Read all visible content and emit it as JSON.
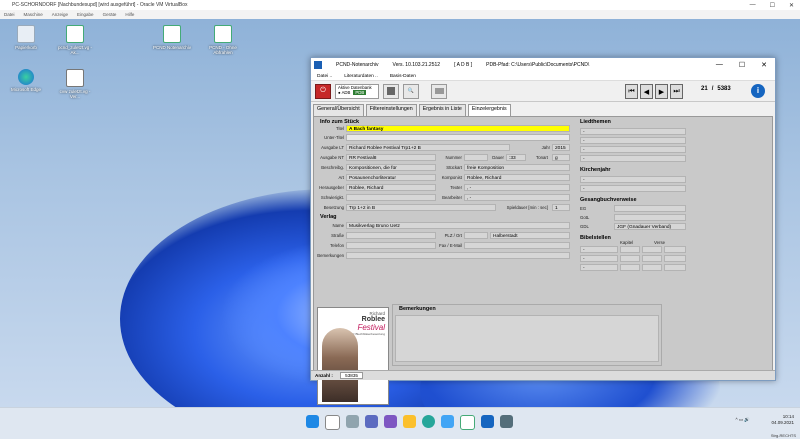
{
  "vbox": {
    "title": "PC-SCHORNDORF [Nachbundesupd] [wird ausgeführt] - Oracle VM VirtualBox",
    "menu": [
      "Datei",
      "Maschine",
      "Anzeige",
      "Eingabe",
      "Geräte",
      "Hilfe"
    ]
  },
  "desktop_icons": [
    {
      "label": "Papierkorb"
    },
    {
      "label": "pcnd_zuletzt.vg - Ak..."
    },
    {
      "label": "PCND Notenarchiv"
    },
    {
      "label": "PCND - Ohne Abfrahlen"
    },
    {
      "label": "Microsoft Edge"
    },
    {
      "label": "cvw zuletzt.vg - Ver..."
    }
  ],
  "app": {
    "title": "PCND-Notenarchiv",
    "version": "Vers. 10.103.21.2512",
    "adb": "[ A D B ]",
    "path": "PDB-Pfad: C:\\Users\\Public\\Documents\\PCND\\",
    "menu": [
      "Datei ..",
      "Literaturdaten ..",
      "Basis-Daten"
    ],
    "aktive_db_label": "Aktive Datenbank",
    "db_options": [
      "ADB",
      "PDB"
    ],
    "record_pos": "21",
    "record_sep": "/",
    "record_total": "5383",
    "tabs": [
      "General/Übersicht",
      "Filtereinstellungen",
      "Ergebnis in Liste",
      "Einzelergebnis"
    ],
    "info_section": "Info zum Stück",
    "fields": {
      "titel_l": "Titel",
      "titel": "A Bach fantasy",
      "untertitel_l": "Unter-Titel",
      "untertitel": "",
      "ausgabe_lt_l": "Ausgabe LT",
      "ausgabe_lt": "Richard Roblee Festival Trp1+2 B",
      "jahr_l": "Jahr",
      "jahr": "2015",
      "ausgabe_nt_l": "Ausgabe NT",
      "ausgabe_nt": "RR Festival8",
      "nummer_l": "Nummer",
      "nummer": "",
      "dauer_l": "Dauer",
      "dauer": ":33",
      "tonart_l": "Tonart",
      "tonart": "g",
      "beschreibung_l": "Beschreibg.",
      "beschreibung": "Kompositionen, die für",
      "stueckart_l": "Stückart",
      "stueckart": "freie Komposition",
      "art_l": "Art",
      "art": "Posaunenchorliteratur",
      "komponist_l": "Komponist",
      "komponist": "Roblee, Richard",
      "herausgeber_l": "Herausgeber",
      "herausgeber": "Roblee, Richard",
      "texter_l": "Texter",
      "texter": ", -",
      "schwierig_l": "Schwierigkt.",
      "schwierig": "",
      "bearbeiter_l": "Bearbeiter",
      "bearbeiter": ", -",
      "besetzung_l": "Besetzung",
      "besetzung": "Trp 1+2 in B",
      "spieldauer_l": "Spieldauer [min : sec]",
      "spieldauer": "1"
    },
    "verlag_section": "Verlag",
    "verlag": {
      "name_l": "Name",
      "name": "Musikverlag Bruno Uetz",
      "strasse_l": "Straße",
      "strasse": "",
      "plz_l": "PLZ / Ort",
      "plz": "",
      "ort": "Halberstadt",
      "telefon_l": "Telefon",
      "telefon": "",
      "fax_l": "Fax / E-Mail",
      "fax": "",
      "bemerkungen_l": "Bemerkungen",
      "bemerkungen": ""
    },
    "bemerkungen_section": "Bemerkungen",
    "liedthemen_section": "Liedthemen",
    "liedthemen": [
      "-",
      "-",
      "-",
      "-"
    ],
    "kirchenjahr_section": "Kirchenjahr",
    "kirchenjahr": [
      "-",
      "-"
    ],
    "gesang_section": "Gesangbuchverweise",
    "gesang": [
      {
        "l": "EG",
        "v": ""
      },
      {
        "l": "GotL",
        "v": ""
      },
      {
        "l": "GDL",
        "v": "JGF (Gnadauer Verband)"
      }
    ],
    "bibel_section": "Bibelstellen",
    "bibel_headers": [
      "Kapitel",
      "Verse"
    ],
    "bibel_rows": [
      "-",
      "-",
      "-"
    ],
    "cover": {
      "name": "Richard",
      "surname": "Roblee",
      "title": "Festival",
      "sub": "für Blechbläserbesetzung"
    },
    "status_label": "Anzahl :",
    "status_value": "53835"
  },
  "taskbar": {
    "time": "10:14",
    "date": "04.09.2021",
    "lang": "Strg-RECHTS"
  }
}
